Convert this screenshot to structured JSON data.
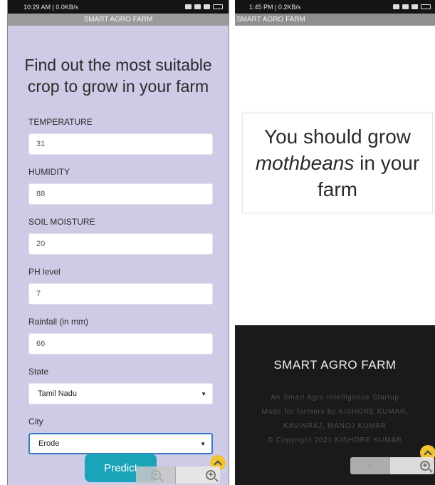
{
  "left_screen": {
    "status": {
      "time": "10:29 AM | 0.0KB/s"
    },
    "app_title": "SMART AGRO FARM",
    "heading": "Find out the most suitable crop to grow in your farm",
    "fields": {
      "temperature": {
        "label": "TEMPERATURE",
        "value": "31"
      },
      "humidity": {
        "label": "HUMIDITY",
        "value": "88"
      },
      "soil_moisture": {
        "label": "SOIL MOISTURE",
        "value": "20"
      },
      "ph": {
        "label": "PH level",
        "value": "7"
      },
      "rainfall": {
        "label": "Rainfall (in mm)",
        "value": "66"
      },
      "state": {
        "label": "State",
        "value": "Tamil Nadu"
      },
      "city": {
        "label": "City",
        "value": "Erode"
      }
    },
    "predict_label": "Predict",
    "zoom_out_icon": "zoom-out-icon",
    "zoom_in_icon": "zoom-in-icon"
  },
  "right_screen": {
    "status": {
      "time": "1:45 PM | 0.2KB/s"
    },
    "app_title": "SMART AGRO FARM",
    "result": {
      "prefix": "You should grow",
      "crop": "mothbeans",
      "suffix": "in your farm"
    },
    "footer": {
      "title": "SMART AGRO FARM",
      "tagline": "An Smart Agro Intelligence Startup",
      "credits_line1": "Made for farmers by KISHORE KUMAR,",
      "credits_line2": "KAVINRAJ, MANOJ KUMAR",
      "copyright": "© Copyright 2021 KISHORE KUMAR"
    }
  },
  "colors": {
    "form_background": "#cdcbe6",
    "predict_button": "#1aa3b9",
    "footer_background": "#1a1a1a",
    "scroll_button": "#f1c232"
  }
}
